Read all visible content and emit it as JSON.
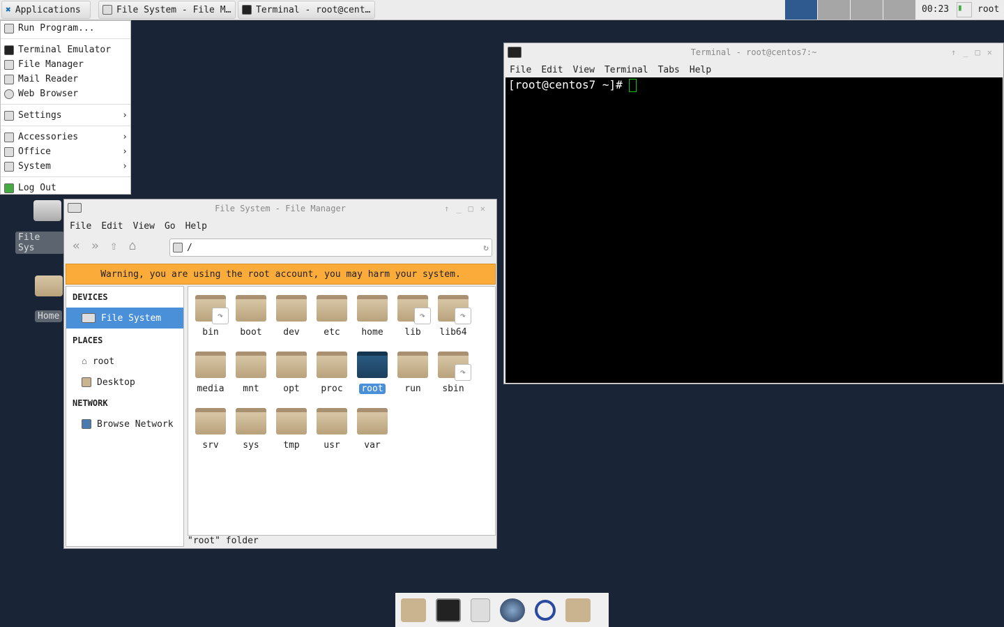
{
  "panel": {
    "apps_label": "Applications",
    "tasks": [
      "File System - File M…",
      "Terminal - root@cent…"
    ],
    "clock": "00:23",
    "user": "root"
  },
  "menu": {
    "items": [
      "Run Program...",
      "Terminal Emulator",
      "File Manager",
      "Mail Reader",
      "Web Browser",
      "Settings",
      "Accessories",
      "Office",
      "System",
      "Log Out"
    ]
  },
  "desktop": {
    "icons": [
      "File Sys",
      "Home"
    ]
  },
  "file_manager": {
    "title": "File System - File Manager",
    "menus": [
      "File",
      "Edit",
      "View",
      "Go",
      "Help"
    ],
    "path": "/",
    "warning": "Warning, you are using the root account, you may harm your system.",
    "sidebar": {
      "devices_header": "DEVICES",
      "devices": [
        "File System"
      ],
      "places_header": "PLACES",
      "places": [
        "root",
        "Desktop"
      ],
      "network_header": "NETWORK",
      "network": [
        "Browse Network"
      ]
    },
    "folders": [
      {
        "name": "bin",
        "link": true
      },
      {
        "name": "boot"
      },
      {
        "name": "dev"
      },
      {
        "name": "etc"
      },
      {
        "name": "home"
      },
      {
        "name": "lib",
        "link": true
      },
      {
        "name": "lib64",
        "link": true
      },
      {
        "name": "media"
      },
      {
        "name": "mnt"
      },
      {
        "name": "opt"
      },
      {
        "name": "proc"
      },
      {
        "name": "root",
        "selected": true
      },
      {
        "name": "run"
      },
      {
        "name": "sbin",
        "link": true
      },
      {
        "name": "srv"
      },
      {
        "name": "sys"
      },
      {
        "name": "tmp"
      },
      {
        "name": "usr"
      },
      {
        "name": "var"
      }
    ],
    "status": "\"root\" folder"
  },
  "terminal": {
    "title": "Terminal - root@centos7:~",
    "menus": [
      "File",
      "Edit",
      "View",
      "Terminal",
      "Tabs",
      "Help"
    ],
    "prompt": "[root@centos7 ~]#"
  },
  "colors": {
    "desktop": "#1a2437",
    "warning": "#fbab3a",
    "selection": "#4a90d9"
  }
}
